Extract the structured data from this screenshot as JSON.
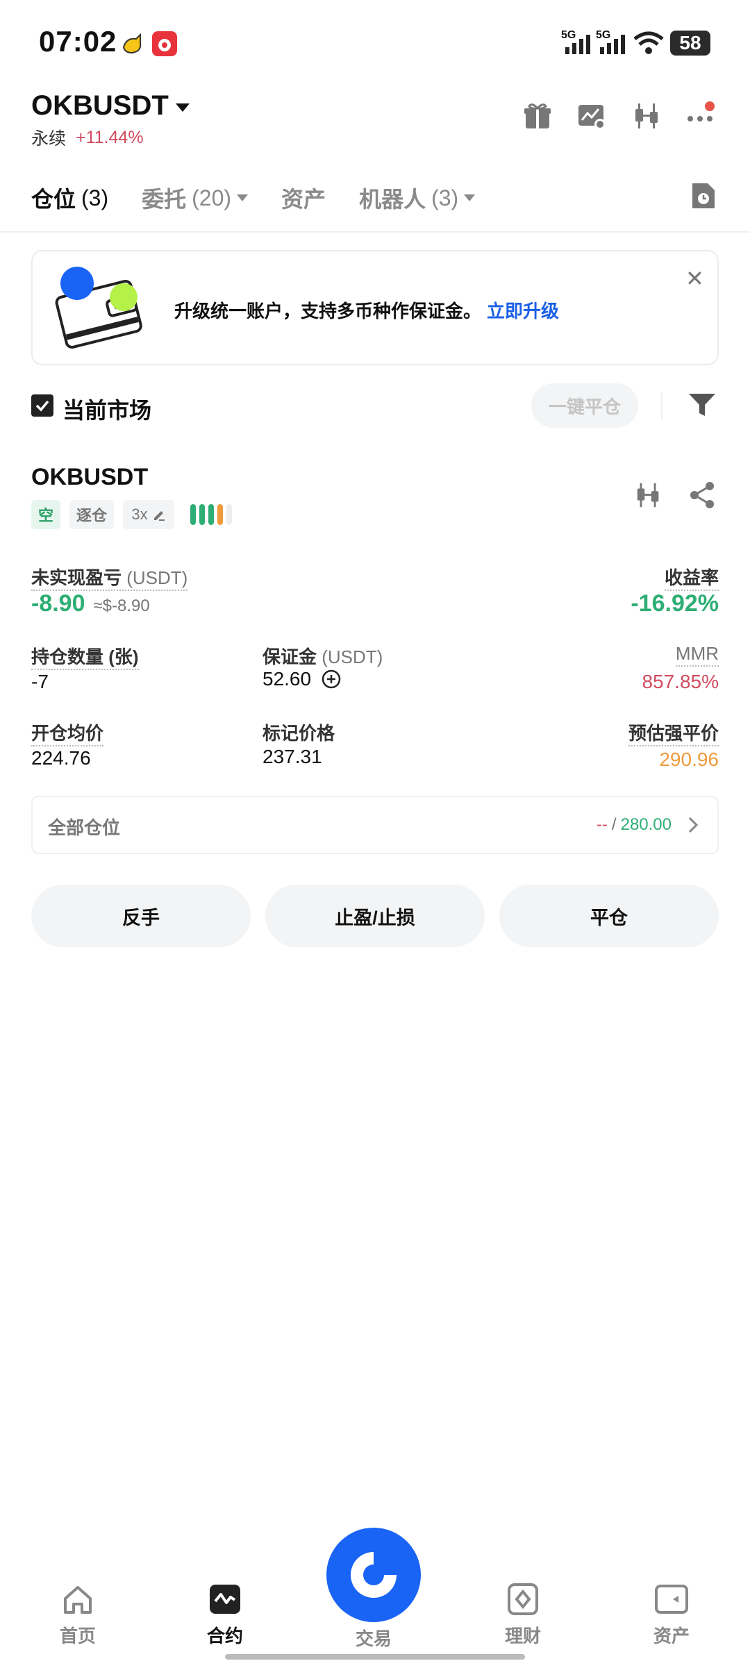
{
  "status_bar": {
    "time": "07:02",
    "signal_1": "5G",
    "signal_2": "5G",
    "battery": "58"
  },
  "header": {
    "pair": "OKBUSDT",
    "contract_type": "永续",
    "change": "+11.44%"
  },
  "tabs": [
    {
      "label": "仓位",
      "count": "(3)"
    },
    {
      "label": "委托",
      "count": "(20)"
    },
    {
      "label": "资产",
      "count": ""
    },
    {
      "label": "机器人",
      "count": "(3)"
    }
  ],
  "banner": {
    "text": "升级统一账户，支持多币种作保证金。",
    "link": "立即升级",
    "close": "✕"
  },
  "filter": {
    "current_market_label": "当前市场",
    "close_all_label": "一键平仓"
  },
  "position": {
    "symbol": "OKBUSDT",
    "side_tag": "空",
    "margin_mode_tag": "逐仓",
    "leverage_tag": "3x",
    "unrealized_pnl": {
      "label": "未实现盈亏",
      "unit": "(USDT)",
      "value": "-8.90",
      "approx": "≈$-8.90"
    },
    "roe": {
      "label": "收益率",
      "value": "-16.92%"
    },
    "size": {
      "label": "持仓数量 (张)",
      "value": "-7"
    },
    "margin": {
      "label": "保证金",
      "unit": "(USDT)",
      "value": "52.60"
    },
    "mmr": {
      "label": "MMR",
      "value": "857.85%"
    },
    "entry_price": {
      "label": "开仓均价",
      "value": "224.76"
    },
    "mark_price": {
      "label": "标记价格",
      "value": "237.31"
    },
    "liq_price": {
      "label": "预估强平价",
      "value": "290.96"
    }
  },
  "all_positions": {
    "label": "全部仓位",
    "pnl": "--",
    "separator": "/",
    "total": "280.00"
  },
  "actions": {
    "reverse": "反手",
    "tp_sl": "止盈/止损",
    "close": "平仓"
  },
  "bottom_nav": [
    {
      "label": "首页"
    },
    {
      "label": "合约"
    },
    {
      "label": "交易"
    },
    {
      "label": "理财"
    },
    {
      "label": "资产"
    }
  ],
  "colors": {
    "accent_blue": "#1a64f5",
    "green": "#2eae74",
    "red": "#d24a5f",
    "orange": "#f09a3e"
  }
}
